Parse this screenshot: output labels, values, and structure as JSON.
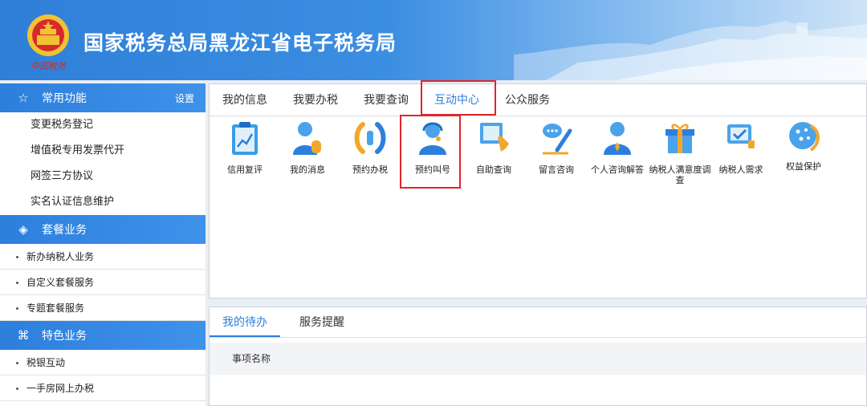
{
  "header": {
    "title": "国家税务总局黑龙江省电子税务局",
    "emblem_icon": "tax-emblem-icon",
    "emblem_caption": "中国税务"
  },
  "sidebar": {
    "common": {
      "title": "常用功能",
      "icon": "star-icon",
      "settings_label": "设置",
      "items": [
        "变更税务登记",
        "增值税专用发票代开",
        "网签三方协议",
        "实名认证信息维护"
      ]
    },
    "package": {
      "title": "套餐业务",
      "icon": "layers-icon",
      "items": [
        "新办纳税人业务",
        "自定义套餐服务",
        "专题套餐服务"
      ]
    },
    "special": {
      "title": "特色业务",
      "icon": "grid-icon",
      "items": [
        "税银互动",
        "一手房网上办税"
      ]
    }
  },
  "main": {
    "tabs": [
      "我的信息",
      "我要办税",
      "我要查询",
      "互动中心",
      "公众服务"
    ],
    "active_tab": "互动中心",
    "functions": [
      {
        "label": "信用复评",
        "icon": "credit-review-icon"
      },
      {
        "label": "我的消息",
        "icon": "message-person-icon"
      },
      {
        "label": "预约办税",
        "icon": "phone-icon"
      },
      {
        "label": "预约叫号",
        "icon": "headset-person-icon"
      },
      {
        "label": "自助查询",
        "icon": "touch-screen-icon"
      },
      {
        "label": "留言咨询",
        "icon": "chat-pen-icon"
      },
      {
        "label": "个人咨询解答",
        "icon": "person-icon"
      },
      {
        "label": "纳税人满意度调查",
        "icon": "gift-icon"
      },
      {
        "label": "纳税人需求",
        "icon": "checkbox-monitor-icon"
      },
      {
        "label": "权益保护",
        "icon": "shield-cookie-icon"
      }
    ]
  },
  "todo": {
    "tabs": [
      "我的待办",
      "服务提醒"
    ],
    "active_tab": "我的待办",
    "columns": [
      "事项名称"
    ]
  },
  "colors": {
    "accent": "#2d7fdc",
    "highlight_box": "#e0262a",
    "header_start": "#2f7fd8"
  }
}
